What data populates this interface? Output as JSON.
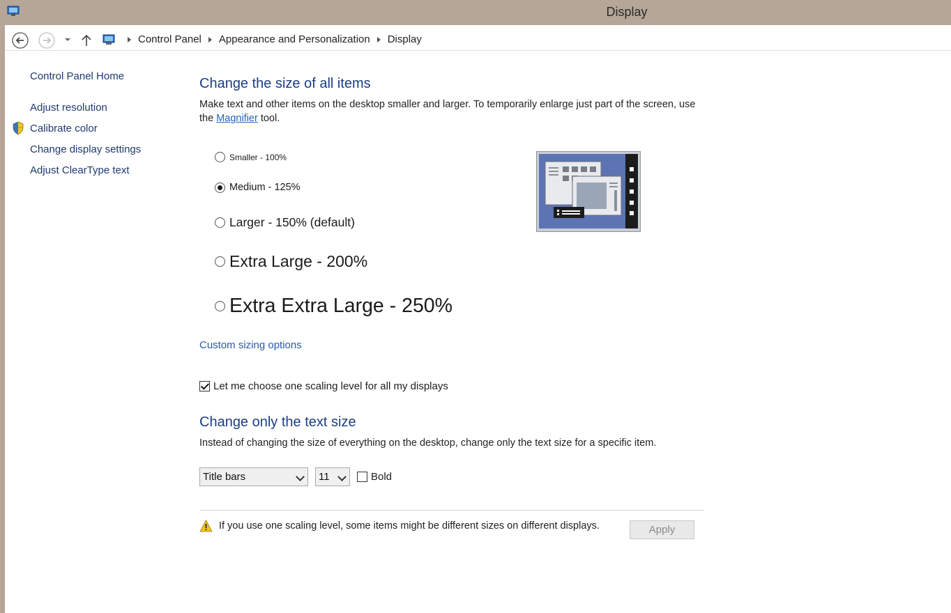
{
  "window": {
    "title": "Display"
  },
  "breadcrumb": [
    "Control Panel",
    "Appearance and Personalization",
    "Display"
  ],
  "sidebar": {
    "home": "Control Panel Home",
    "items": [
      "Adjust resolution",
      "Calibrate color",
      "Change display settings",
      "Adjust ClearType text"
    ]
  },
  "main": {
    "heading": "Change the size of all items",
    "intro_before": "Make text and other items on the desktop smaller and larger. To temporarily enlarge just part of the screen, use the ",
    "intro_link": "Magnifier",
    "intro_after": " tool.",
    "options": [
      {
        "label": "Smaller - 100%",
        "checked": false
      },
      {
        "label": "Medium - 125%",
        "checked": true
      },
      {
        "label": "Larger - 150% (default)",
        "checked": false
      },
      {
        "label": "Extra Large - 200%",
        "checked": false
      },
      {
        "label": "Extra Extra Large - 250%",
        "checked": false
      }
    ],
    "custom_link": "Custom sizing options",
    "scaling_checkbox": {
      "label": "Let me choose one scaling level for all my displays",
      "checked": true
    },
    "text_heading": "Change only the text size",
    "text_intro": "Instead of changing the size of everything on the desktop, change only the text size for a specific item.",
    "item_select": "Title bars",
    "size_select": "11",
    "bold_label": "Bold",
    "warning": "If you use one scaling level, some items might be different sizes on different displays.",
    "apply": "Apply"
  },
  "colors": {
    "frame": "#b5a697",
    "heading": "#1b3d86",
    "link": "#2a5aa8"
  },
  "icons": [
    "back-arrow-icon",
    "forward-arrow-icon",
    "dropdown-icon",
    "up-arrow-icon",
    "computer-icon",
    "shield-icon",
    "warning-icon"
  ]
}
